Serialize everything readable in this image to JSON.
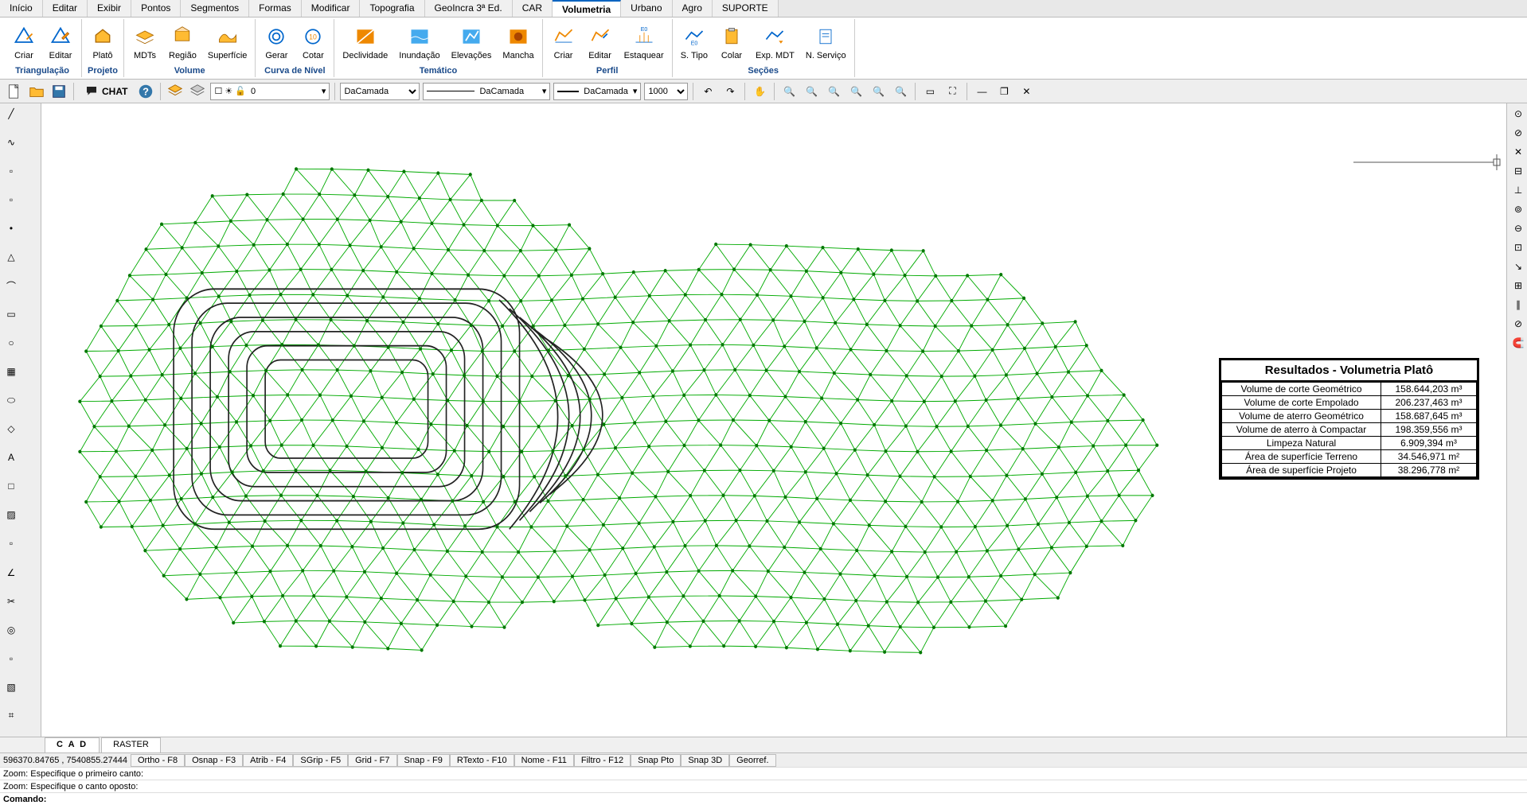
{
  "menu": {
    "tabs": [
      "Início",
      "Editar",
      "Exibir",
      "Pontos",
      "Segmentos",
      "Formas",
      "Modificar",
      "Topografia",
      "GeoIncra 3ª Ed.",
      "CAR",
      "Volumetria",
      "Urbano",
      "Agro",
      "SUPORTE"
    ],
    "active": "Volumetria"
  },
  "ribbon": {
    "groups": [
      {
        "label": "Triangulação",
        "items": [
          {
            "id": "criar-tri",
            "label": "Criar",
            "icon": "triangle-create"
          },
          {
            "id": "editar-tri",
            "label": "Editar",
            "icon": "triangle-edit"
          }
        ]
      },
      {
        "label": "Projeto",
        "items": [
          {
            "id": "plato",
            "label": "Platô",
            "icon": "house"
          }
        ]
      },
      {
        "label": "Volume",
        "items": [
          {
            "id": "mdts",
            "label": "MDTs",
            "icon": "layers"
          },
          {
            "id": "regiao",
            "label": "Região",
            "icon": "region"
          },
          {
            "id": "superficie",
            "label": "Superfície",
            "icon": "surface"
          }
        ]
      },
      {
        "label": "Curva de Nível",
        "items": [
          {
            "id": "gerar",
            "label": "Gerar",
            "icon": "contour"
          },
          {
            "id": "cotar",
            "label": "Cotar",
            "icon": "contour-label"
          }
        ]
      },
      {
        "label": "Temático",
        "items": [
          {
            "id": "declividade",
            "label": "Declividade",
            "icon": "slope"
          },
          {
            "id": "inundacao",
            "label": "Inundação",
            "icon": "flood"
          },
          {
            "id": "elevacoes",
            "label": "Elevações",
            "icon": "elevation"
          },
          {
            "id": "mancha",
            "label": "Mancha",
            "icon": "stain"
          }
        ]
      },
      {
        "label": "Perfil",
        "items": [
          {
            "id": "criar-perfil",
            "label": "Criar",
            "icon": "profile-create"
          },
          {
            "id": "editar-perfil",
            "label": "Editar",
            "icon": "profile-edit"
          },
          {
            "id": "estaquear",
            "label": "Estaquear",
            "icon": "stake"
          }
        ]
      },
      {
        "label": "Seções",
        "items": [
          {
            "id": "stipo",
            "label": "S. Tipo",
            "icon": "section"
          },
          {
            "id": "colar",
            "label": "Colar",
            "icon": "paste"
          },
          {
            "id": "expmdt",
            "label": "Exp. MDT",
            "icon": "export"
          },
          {
            "id": "nservico",
            "label": "N. Serviço",
            "icon": "note"
          }
        ]
      }
    ]
  },
  "toolbar2": {
    "chat": "CHAT",
    "layer": "0",
    "linetype": "DaCamada",
    "lineweight": "DaCamada",
    "lineweight2": "DaCamada",
    "scale": "1000"
  },
  "left_tools": [
    "line",
    "polyline",
    "arc-left",
    "arc-right",
    "point",
    "triangle",
    "curve",
    "rect",
    "circle",
    "grid",
    "ellipse",
    "diamond",
    "text",
    "square",
    "paint",
    "rect2",
    "angle",
    "cut",
    "donut",
    "rect3",
    "hatch",
    "crop"
  ],
  "right_tools": [
    "endpoint",
    "midpoint",
    "snap",
    "break",
    "perp",
    "center",
    "tangent",
    "node",
    "near",
    "insert",
    "parallel",
    "none",
    "magnet"
  ],
  "results": {
    "title": "Resultados - Volumetria Platô",
    "rows": [
      {
        "label": "Volume de corte Geométrico",
        "value": "158.644,203 m³"
      },
      {
        "label": "Volume de corte Empolado",
        "value": "206.237,463 m³"
      },
      {
        "label": "Volume de aterro Geométrico",
        "value": "158.687,645 m³"
      },
      {
        "label": "Volume de aterro à Compactar",
        "value": "198.359,556 m³"
      },
      {
        "label": "Limpeza Natural",
        "value": "6.909,394 m³"
      },
      {
        "label": "Área de superfície Terreno",
        "value": "34.546,971 m²"
      },
      {
        "label": "Área de superfície Projeto",
        "value": "38.296,778 m²"
      }
    ]
  },
  "bottom_tabs": {
    "items": [
      "C A D",
      "RASTER"
    ],
    "active": "C A D"
  },
  "status": {
    "coords": "596370.84765 , 7540855.27444",
    "cells": [
      "Ortho - F8",
      "Osnap - F3",
      "Atrib - F4",
      "SGrip - F5",
      "Grid - F7",
      "Snap - F9",
      "RTexto - F10",
      "Nome - F11",
      "Filtro - F12",
      "Snap Pto",
      "Snap 3D",
      "Georref."
    ]
  },
  "log1": "Zoom: Especifique o primeiro canto:",
  "log2": "Zoom: Especifique o canto oposto:",
  "cmd_label": "Comando:"
}
